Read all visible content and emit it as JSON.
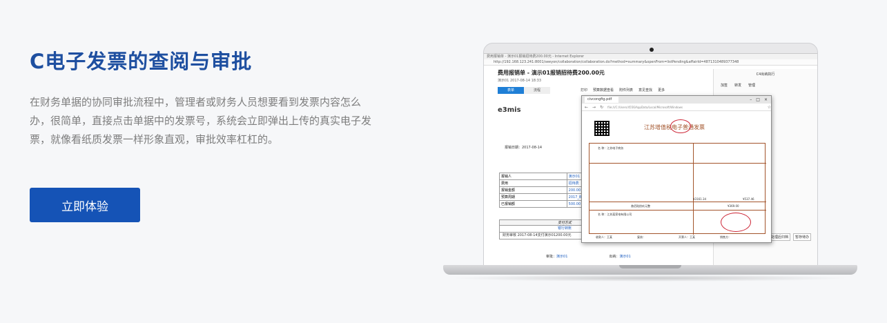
{
  "hero": {
    "title": "C电子发票的查阅与审批",
    "description": "在财务单据的协同审批流程中，管理者或财务人员想要看到发票内容怎么办，很简单，直接点击单据中的发票号，系统会立即弹出上传的真实电子发票，就像看纸质发票一样形象直观，审批效率杠杠的。",
    "cta_label": "立即体验"
  },
  "screen": {
    "window_title": "费用报销单 - 演示01报销招待费200.00元 - Internet Explorer",
    "address": "http://192.168.123.241:8001/seeyon/collaboration/collaboration.do?method=summary&openFrom=listPending&affairId=4871310489377348",
    "form_title": "费用报销单 - 演示01报销招待费200.00元",
    "form_sub": "演示01    2017-08-14 18:33",
    "tabs": [
      "表单",
      "流程"
    ],
    "toolbar": [
      "打印",
      "预算数据查看",
      "附件列表",
      "意见查找",
      "更多"
    ],
    "logo": "e3mis",
    "report_date": "报销日期：2017-08-14",
    "rows": [
      {
        "label": "报销人",
        "value": "演示01"
      },
      {
        "label": "费用",
        "value": "招待费"
      },
      {
        "label": "报销金额",
        "value": "200.00"
      },
      {
        "label": "预算周期",
        "value": "2017_8"
      },
      {
        "label": "已报销额",
        "value": "500.00"
      }
    ],
    "payment_header": "支付方式",
    "payment_value": "银行转账",
    "finance_row": "财务审核    2017-08-14支付演示01200.00元",
    "footer": {
      "approve_label": "审批：",
      "approve_value": "演示01",
      "exec_label": "出纳：",
      "exec_value": "演示01"
    },
    "right_panel": {
      "title": "C4出纳执行",
      "actions": [
        "加签",
        "转发",
        "管理"
      ],
      "buttons": [
        "处理后归档",
        "暂存待办"
      ]
    },
    "pdf": {
      "tab": "civcongfig.pdf",
      "url": "file:///C:/Users/4556/AppData/Local/Microsoft/Windows",
      "invoice_title": "江苏增值税电子普通发票",
      "buyer": "名    称：江苏电子商务",
      "amount_cn": "叁佰陆拾玖元整",
      "amount": "¥369.00",
      "total": "¥3161.34",
      "tax": "¥537.46",
      "seller": "名    称：江苏某家电有限公司",
      "payee": "收款人：王某",
      "reviewer": "复核：",
      "drawer": "开票人：王某",
      "seller_label": "销售方："
    }
  }
}
